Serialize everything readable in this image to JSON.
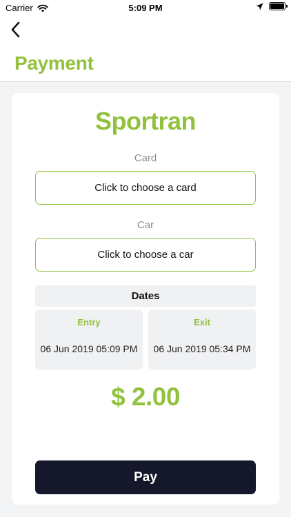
{
  "status_bar": {
    "carrier": "Carrier",
    "time": "5:09 PM"
  },
  "header": {
    "title": "Payment",
    "back_icon": "chevron-left-icon"
  },
  "payment": {
    "brand": "Sportran",
    "card_label": "Card",
    "card_placeholder": "Click to choose a card",
    "car_label": "Car",
    "car_placeholder": "Click to choose a car",
    "dates_heading": "Dates",
    "entry_label": "Entry",
    "entry_value": "06 Jun 2019 05:09 PM",
    "exit_label": "Exit",
    "exit_value": "06 Jun 2019 05:34 PM",
    "amount": "$ 2.00",
    "pay_label": "Pay"
  },
  "colors": {
    "accent": "#92c13e",
    "button_dark": "#15172a",
    "background": "#f3f4f6"
  }
}
